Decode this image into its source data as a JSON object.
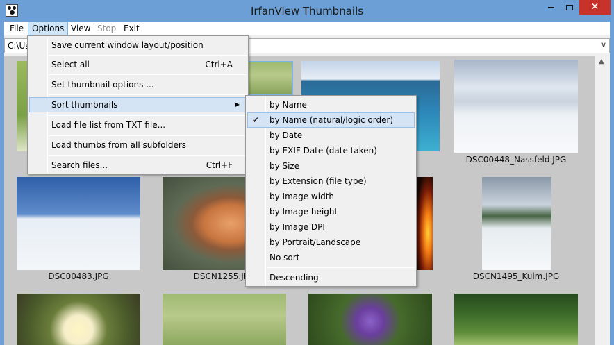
{
  "window": {
    "title": "IrfanView Thumbnails",
    "close_glyph": "✕"
  },
  "menubar": {
    "items": [
      "File",
      "Options",
      "View",
      "Stop",
      "Exit"
    ]
  },
  "path": {
    "value": "C:\\Us",
    "dropdown_glyph": "∨"
  },
  "thumbnails": [
    {
      "caption": "DSC00448_Nassfeld.JPG",
      "icon": "mountain-scene"
    },
    {
      "caption": "DSC00483.JPG",
      "icon": "skier-scene"
    },
    {
      "caption": "DSCN1255.JPG",
      "icon": "tree-trunk-scene"
    },
    {
      "caption": "DSCN1495_Kulm.JPG",
      "icon": "ski-jump-scene"
    }
  ],
  "options_menu": {
    "items": [
      {
        "label": "Save current window layout/position",
        "shortcut": ""
      },
      {
        "label": "Select all",
        "shortcut": "Ctrl+A"
      },
      {
        "label": "Set thumbnail options ...",
        "shortcut": ""
      },
      {
        "label": "Sort thumbnails",
        "shortcut": "",
        "submenu_arrow": "▶"
      },
      {
        "label": "Load file list  from TXT file...",
        "shortcut": ""
      },
      {
        "label": "Load thumbs from all subfolders",
        "shortcut": ""
      },
      {
        "label": "Search files...",
        "shortcut": "Ctrl+F"
      }
    ]
  },
  "sort_submenu": {
    "check_glyph": "✔",
    "items": [
      {
        "label": "by Name",
        "checked": false
      },
      {
        "label": "by Name (natural/logic order)",
        "checked": true
      },
      {
        "label": "by Date",
        "checked": false
      },
      {
        "label": "by EXIF Date (date taken)",
        "checked": false
      },
      {
        "label": "by Size",
        "checked": false
      },
      {
        "label": "by Extension (file type)",
        "checked": false
      },
      {
        "label": "by Image width",
        "checked": false
      },
      {
        "label": "by Image height",
        "checked": false
      },
      {
        "label": "by Image DPI",
        "checked": false
      },
      {
        "label": "by Portrait/Landscape",
        "checked": false
      },
      {
        "label": "No sort",
        "checked": false
      },
      {
        "label": "Descending",
        "checked": false
      }
    ]
  },
  "colors": {
    "titlebar": "#6b9fd6",
    "close_button": "#c7322a",
    "menu_highlight": "#d5e4f5",
    "thumb_background": "#c8c8c8"
  }
}
